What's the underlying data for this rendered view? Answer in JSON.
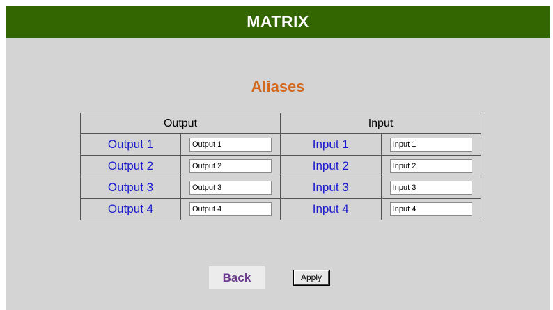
{
  "header": {
    "title": "MATRIX"
  },
  "page_title": "Aliases",
  "table": {
    "output_header": "Output",
    "input_header": "Input",
    "rows": [
      {
        "output_label": "Output 1",
        "output_value": "Output 1",
        "input_label": "Input 1",
        "input_value": "Input 1"
      },
      {
        "output_label": "Output 2",
        "output_value": "Output 2",
        "input_label": "Input 2",
        "input_value": "Input 2"
      },
      {
        "output_label": "Output 3",
        "output_value": "Output 3",
        "input_label": "Input 3",
        "input_value": "Input 3"
      },
      {
        "output_label": "Output 4",
        "output_value": "Output 4",
        "input_label": "Input 4",
        "input_value": "Input 4"
      }
    ]
  },
  "buttons": {
    "back_label": "Back",
    "apply_label": "Apply"
  },
  "colors": {
    "header_bg": "#336600",
    "title_orange": "#d4691d",
    "label_blue": "#1a1acc",
    "panel_gray": "#d4d4d4"
  }
}
